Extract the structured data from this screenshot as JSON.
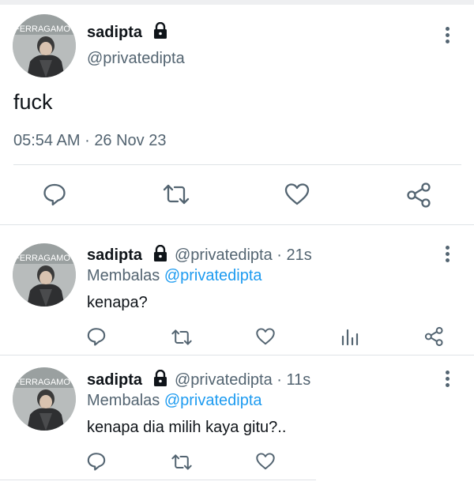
{
  "main_tweet": {
    "display_name": "sadipta",
    "handle": "@privatedipta",
    "text": "fuck",
    "time": "05:54 AM",
    "separator": "·",
    "date": "26 Nov 23",
    "avatar_text": "FERRAGAMO"
  },
  "replies": [
    {
      "display_name": "sadipta",
      "handle_time": "@privatedipta · 21s",
      "replying_label": "Membalas",
      "replying_to": "@privatedipta",
      "text": "kenapa?",
      "avatar_text": "FERRAGAMO"
    },
    {
      "display_name": "sadipta",
      "handle_time": "@privatedipta · 11s",
      "replying_label": "Membalas",
      "replying_to": "@privatedipta",
      "text": "kenapa dia milih kaya gitu?..",
      "avatar_text": "FERRAGAMO"
    }
  ],
  "icons": {
    "lock": "lock-icon",
    "more": "more-vertical-icon",
    "reply": "reply-icon",
    "retweet": "retweet-icon",
    "like": "heart-icon",
    "views": "analytics-icon",
    "share": "share-icon"
  },
  "colors": {
    "text": "#0f1419",
    "secondary": "#536471",
    "mention": "#1d9bf0",
    "divider": "#dfe3e7"
  }
}
